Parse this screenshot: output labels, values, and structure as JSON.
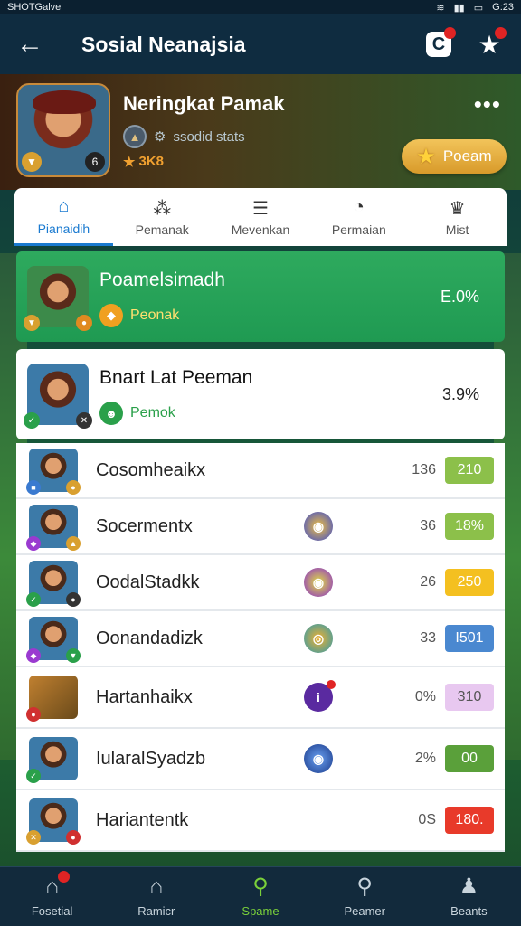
{
  "status_bar": {
    "left": "SHOTGalvel",
    "time": "G:23"
  },
  "app_bar": {
    "title": "Sosial Neanajsia"
  },
  "profile": {
    "name": "Neringkat Pamak",
    "subtitle": "ssodid stats",
    "score": "3K8",
    "action_label": "Poeam"
  },
  "tabs": [
    {
      "label": "Pianaidih",
      "icon": "home-icon",
      "active": true
    },
    {
      "label": "Pemanak",
      "icon": "group-icon",
      "active": false
    },
    {
      "label": "Mevenkan",
      "icon": "list-icon",
      "active": false
    },
    {
      "label": "Permaian",
      "icon": "gauge-icon",
      "active": false
    },
    {
      "label": "Mist",
      "icon": "crown-icon",
      "active": false
    }
  ],
  "featured": [
    {
      "title": "Poamelsimadh",
      "subtitle": "Peonak",
      "value": "E.0%",
      "accent": "#1f9a52"
    },
    {
      "title": "Bnart Lat Peeman",
      "subtitle": "Pemok",
      "value": "3.9%",
      "accent": "#ffffff"
    }
  ],
  "rows": [
    {
      "name": "Cosomheaikx",
      "count": "136",
      "pill": "210",
      "pill_color": "#8cc04a"
    },
    {
      "name": "Socermentx",
      "count": "36",
      "pill": "18%",
      "pill_color": "#8cc04a"
    },
    {
      "name": "OodalStadkk",
      "count": "26",
      "pill": "250",
      "pill_color": "#f4c020"
    },
    {
      "name": "Oonandadizk",
      "count": "33",
      "pill": "I501",
      "pill_color": "#4a88d0"
    },
    {
      "name": "Hartanhaikx",
      "count": "0%",
      "pill": "310",
      "pill_color": "#e8c8f0"
    },
    {
      "name": "IularalSyadzb",
      "count": "2%",
      "pill": "00",
      "pill_color": "#5aa03a"
    },
    {
      "name": "Hariantentk",
      "count": "0S",
      "pill": "180.",
      "pill_color": "#e83a2a"
    }
  ],
  "bottom_nav": [
    {
      "label": "Fosetial",
      "icon": "home-icon",
      "active": false
    },
    {
      "label": "Ramicr",
      "icon": "house-outline-icon",
      "active": false
    },
    {
      "label": "Spame",
      "icon": "search-badge-icon",
      "active": true
    },
    {
      "label": "Peamer",
      "icon": "search-icon",
      "active": false
    },
    {
      "label": "Beants",
      "icon": "person-icon",
      "active": false
    }
  ]
}
